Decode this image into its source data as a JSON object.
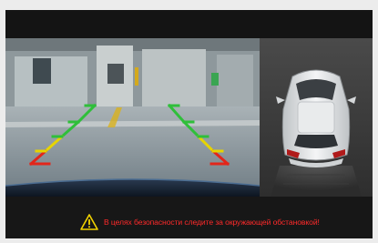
{
  "warning": {
    "message": "В целях безопасности следите за окружающей обстановкой!",
    "icon": "warning-triangle-icon"
  },
  "colors": {
    "guide_far": "#2fbf3a",
    "guide_mid": "#e6d400",
    "guide_near": "#e3261a",
    "warning_text": "#ff2a2a",
    "warning_icon": "#f2d200"
  }
}
